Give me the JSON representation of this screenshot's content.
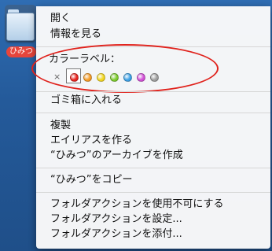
{
  "desktop": {
    "folder_label": "ひみつ"
  },
  "menu": {
    "open": "開く",
    "get_info": "情報を見る",
    "color_label_title": "カラーラベル：",
    "move_to_trash": "ゴミ箱に入れる",
    "duplicate": "複製",
    "make_alias": "エイリアスを作る",
    "create_archive": "“ひみつ”のアーカイブを作成",
    "copy": "“ひみつ”をコピー",
    "folder_actions_disable": "フォルダアクションを使用不可にする",
    "folder_actions_configure": "フォルダアクションを設定...",
    "folder_actions_attach": "フォルダアクションを添付..."
  },
  "color_labels": {
    "none": "×",
    "colors": [
      {
        "name": "red",
        "hex": "#e8231d",
        "selected": true
      },
      {
        "name": "orange",
        "hex": "#f59a23"
      },
      {
        "name": "yellow",
        "hex": "#f2d61f"
      },
      {
        "name": "green",
        "hex": "#7ccb2c"
      },
      {
        "name": "blue",
        "hex": "#3aa0e6"
      },
      {
        "name": "purple",
        "hex": "#d24fd6"
      },
      {
        "name": "gray",
        "hex": "#9d9d9d"
      }
    ]
  },
  "annotation": {
    "color": "#e0221c"
  }
}
